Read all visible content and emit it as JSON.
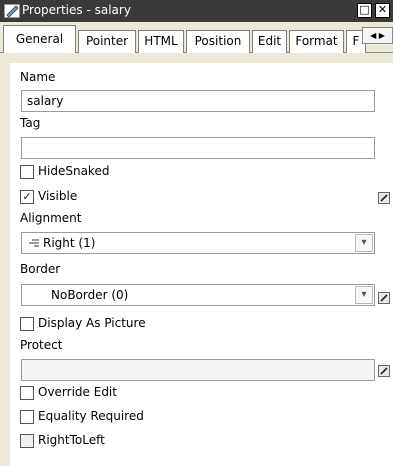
{
  "window": {
    "title": "Properties - salary",
    "minimize_glyph": "□",
    "close_glyph": "✕"
  },
  "tabs": [
    "General",
    "Pointer",
    "HTML",
    "Position",
    "Edit",
    "Format",
    "F"
  ],
  "tab_scroll": {
    "left": "◀",
    "right": "▶"
  },
  "fields": {
    "name_label": "Name",
    "name_value": "salary",
    "tag_label": "Tag",
    "tag_value": "",
    "hidesnaked_label": "HideSnaked",
    "hidesnaked_checked": false,
    "visible_label": "Visible",
    "visible_checked": true,
    "alignment_label": "Alignment",
    "alignment_value": "Right (1)",
    "alignment_icon": "align-right-icon",
    "border_label": "Border",
    "border_value": "NoBorder (0)",
    "display_as_picture_label": "Display As Picture",
    "display_as_picture_checked": false,
    "protect_label": "Protect",
    "protect_value": "",
    "override_edit_label": "Override Edit",
    "override_edit_checked": false,
    "equality_required_label": "Equality Required",
    "equality_required_checked": false,
    "righttoleft_label": "RightToLeft",
    "righttoleft_checked": false
  },
  "glyphs": {
    "check": "✓",
    "dropdown": "▾"
  }
}
